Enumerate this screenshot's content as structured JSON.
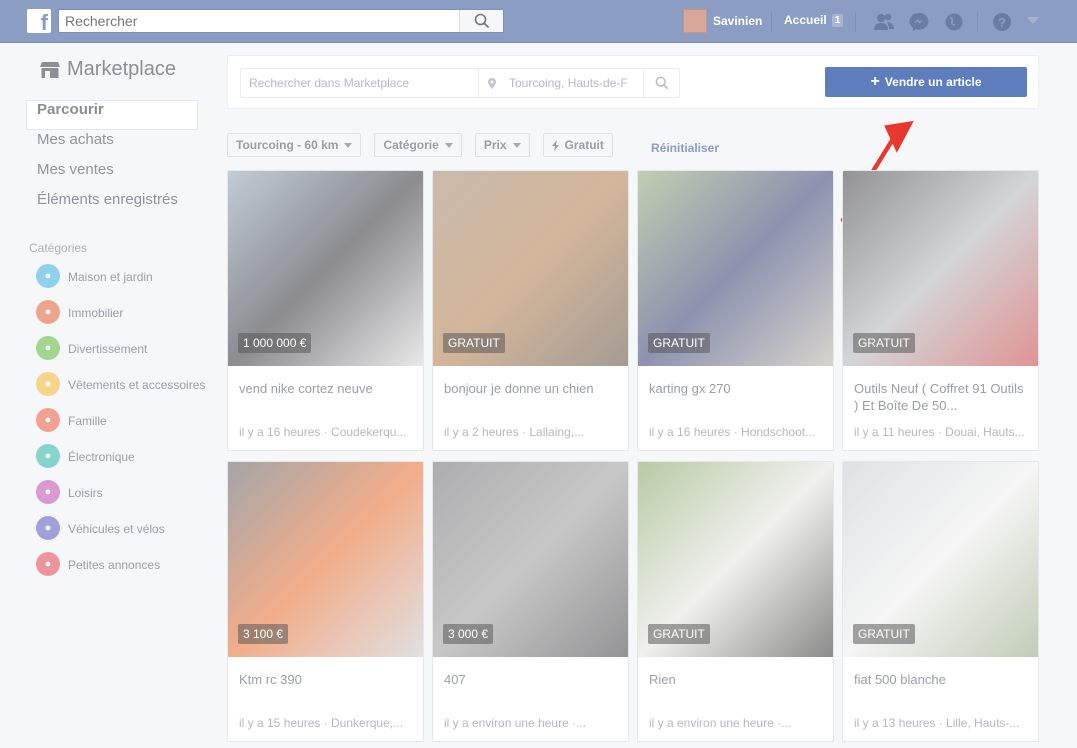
{
  "topbar": {
    "logo": "f",
    "search_placeholder": "Rechercher",
    "user_name": "Savinien",
    "home_label": "Accueil",
    "home_count": "1"
  },
  "sidebar": {
    "title": "Marketplace",
    "nav": [
      "Parcourir",
      "Mes achats",
      "Mes ventes",
      "Éléments enregistrés"
    ],
    "categories_heading": "Catégories",
    "categories": [
      {
        "label": "Maison et jardin",
        "color": "#4cb8e6",
        "icon": "house-icon"
      },
      {
        "label": "Immobilier",
        "color": "#e9704a",
        "icon": "building-icon"
      },
      {
        "label": "Divertissement",
        "color": "#6cbf4b",
        "icon": "gamepad-icon"
      },
      {
        "label": "Vêtements et accessoires",
        "color": "#f5c040",
        "icon": "shirt-icon"
      },
      {
        "label": "Famille",
        "color": "#ef6b4f",
        "icon": "heart-icon"
      },
      {
        "label": "Électronique",
        "color": "#3bbfae",
        "icon": "phone-icon"
      },
      {
        "label": "Loisirs",
        "color": "#c75bb8",
        "icon": "guitar-icon"
      },
      {
        "label": "Véhicules et vélos",
        "color": "#6a68c9",
        "icon": "car-icon"
      },
      {
        "label": "Petites annonces",
        "color": "#e8545f",
        "icon": "gift-icon"
      }
    ]
  },
  "search": {
    "query_placeholder": "Rechercher dans Marketplace",
    "location": "Tourcoing, Hauts-de-F"
  },
  "sell_button": "Vendre un article",
  "filters": {
    "location": "Tourcoing - 60 km",
    "category": "Catégorie",
    "price": "Prix",
    "free": "Gratuit",
    "reset": "Réinitialiser"
  },
  "listings": [
    {
      "price": "1 000 000 €",
      "title": "vend nike cortez neuve",
      "meta": "il y a 16 heures · Coudekerqu...",
      "colors": [
        "#8fa3b5",
        "#2e2e36",
        "#d8d8d8"
      ]
    },
    {
      "price": "GRATUIT",
      "title": "bonjour je donne un chien",
      "meta": "il y a 2 heures · Lallaing,...",
      "colors": [
        "#9b8266",
        "#b07a48",
        "#5a4a3c"
      ]
    },
    {
      "price": "GRATUIT",
      "title": "karting gx 270",
      "meta": "il y a 16 heures · Hondschoot...",
      "colors": [
        "#8ea873",
        "#2f3a6e",
        "#b9b1a5"
      ]
    },
    {
      "price": "GRATUIT",
      "title": "Outils Neuf ( Coffret 91 Outils ) Et Boîte De 50...",
      "meta": "il y a 11 heures · Douai, Hauts...",
      "colors": [
        "#3a3a3c",
        "#b0b3b8",
        "#c83a3a"
      ]
    },
    {
      "price": "3 100 €",
      "title": "Ktm rc 390",
      "meta": "il y a 15 heures · Dunkerque,...",
      "colors": [
        "#5b5c62",
        "#e86a2a",
        "#c8c8cc"
      ]
    },
    {
      "price": "3 000 €",
      "title": "407",
      "meta": "il y a environ une heure ·...",
      "colors": [
        "#6b6b6e",
        "#9a9a9c",
        "#3c3c3f"
      ]
    },
    {
      "price": "GRATUIT",
      "title": "Rien",
      "meta": "il y a environ une heure ·...",
      "colors": [
        "#7da05a",
        "#e5e5e0",
        "#2b2b2b"
      ]
    },
    {
      "price": "GRATUIT",
      "title": "fiat 500 blanche",
      "meta": "il y a 13 heures · Lille, Hauts-...",
      "colors": [
        "#c4c9cd",
        "#eeeeee",
        "#8fa27a"
      ]
    }
  ]
}
